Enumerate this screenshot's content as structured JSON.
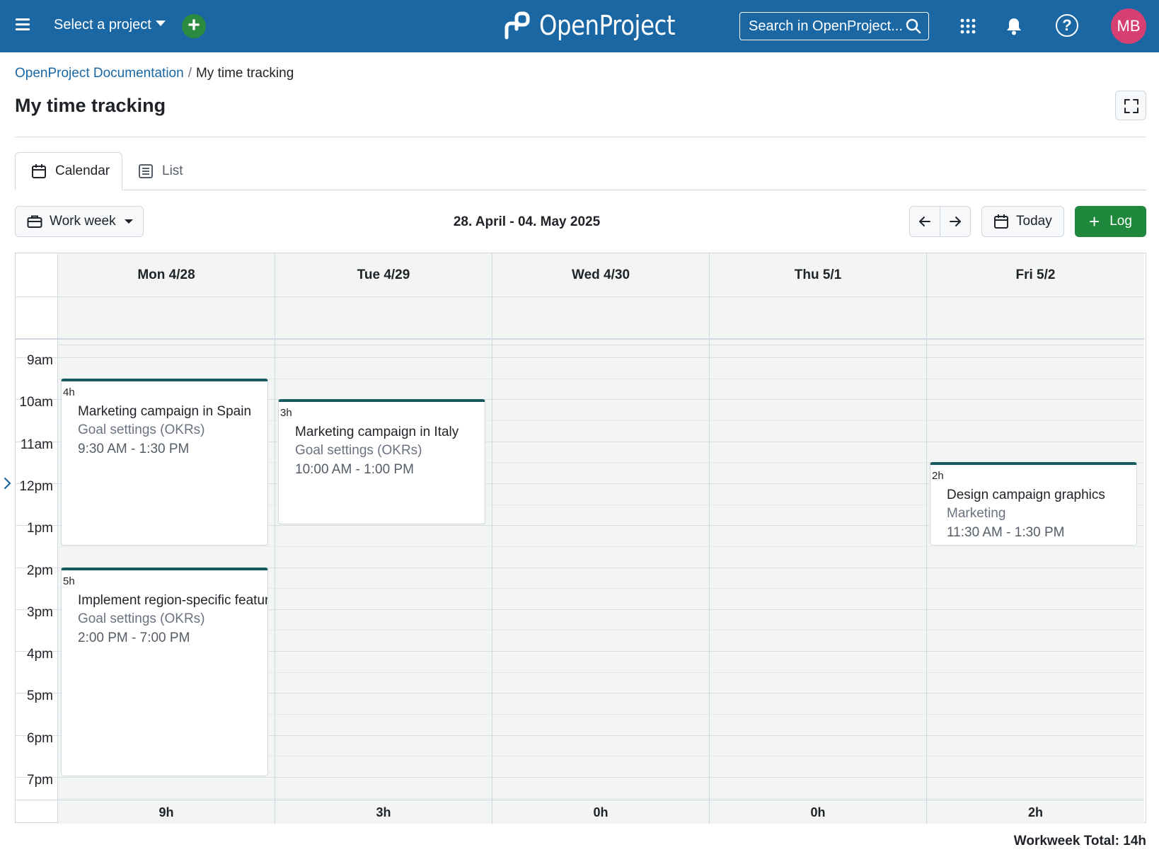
{
  "header": {
    "project_select": "Select a project",
    "logo_text": "OpenProject",
    "search_placeholder": "Search in OpenProject...",
    "avatar_initials": "MB",
    "help_glyph": "?",
    "add_glyph": "+",
    "brand_color": "#1a67a3"
  },
  "breadcrumb": {
    "parent": "OpenProject Documentation",
    "separator": "/",
    "current": "My time tracking"
  },
  "page_title": "My time tracking",
  "tabs": [
    {
      "label": "Calendar",
      "icon": "calendar-icon",
      "active": true
    },
    {
      "label": "List",
      "icon": "list-icon",
      "active": false
    }
  ],
  "toolbar": {
    "view_mode": "Work week",
    "date_range": "28. April - 04. May 2025",
    "today_label": "Today",
    "log_label": "Log",
    "log_glyph": "+"
  },
  "calendar": {
    "days": [
      {
        "label": "Mon 4/28",
        "total": "9h"
      },
      {
        "label": "Tue 4/29",
        "total": "3h"
      },
      {
        "label": "Wed 4/30",
        "total": "0h"
      },
      {
        "label": "Thu 5/1",
        "total": "0h"
      },
      {
        "label": "Fri 5/2",
        "total": "2h"
      }
    ],
    "hours": [
      "9am",
      "10am",
      "11am",
      "12pm",
      "1pm",
      "2pm",
      "3pm",
      "4pm",
      "5pm",
      "6pm",
      "7pm"
    ],
    "events": [
      {
        "duration": "4h",
        "title": "Marketing campaign in Spain",
        "project": "Goal settings (OKRs)",
        "time": "9:30 AM - 1:30 PM"
      },
      {
        "duration": "3h",
        "title": "Marketing campaign in Italy",
        "project": "Goal settings (OKRs)",
        "time": "10:00 AM - 1:00 PM"
      },
      {
        "duration": "5h",
        "title": "Implement region-specific features",
        "project": "Goal settings (OKRs)",
        "time": "2:00 PM - 7:00 PM"
      },
      {
        "duration": "2h",
        "title": "Design campaign graphics",
        "project": "Marketing",
        "time": "11:30 AM - 1:30 PM"
      }
    ],
    "event_accent": "#175a5e"
  },
  "workweek_total": "Workweek Total: 14h"
}
